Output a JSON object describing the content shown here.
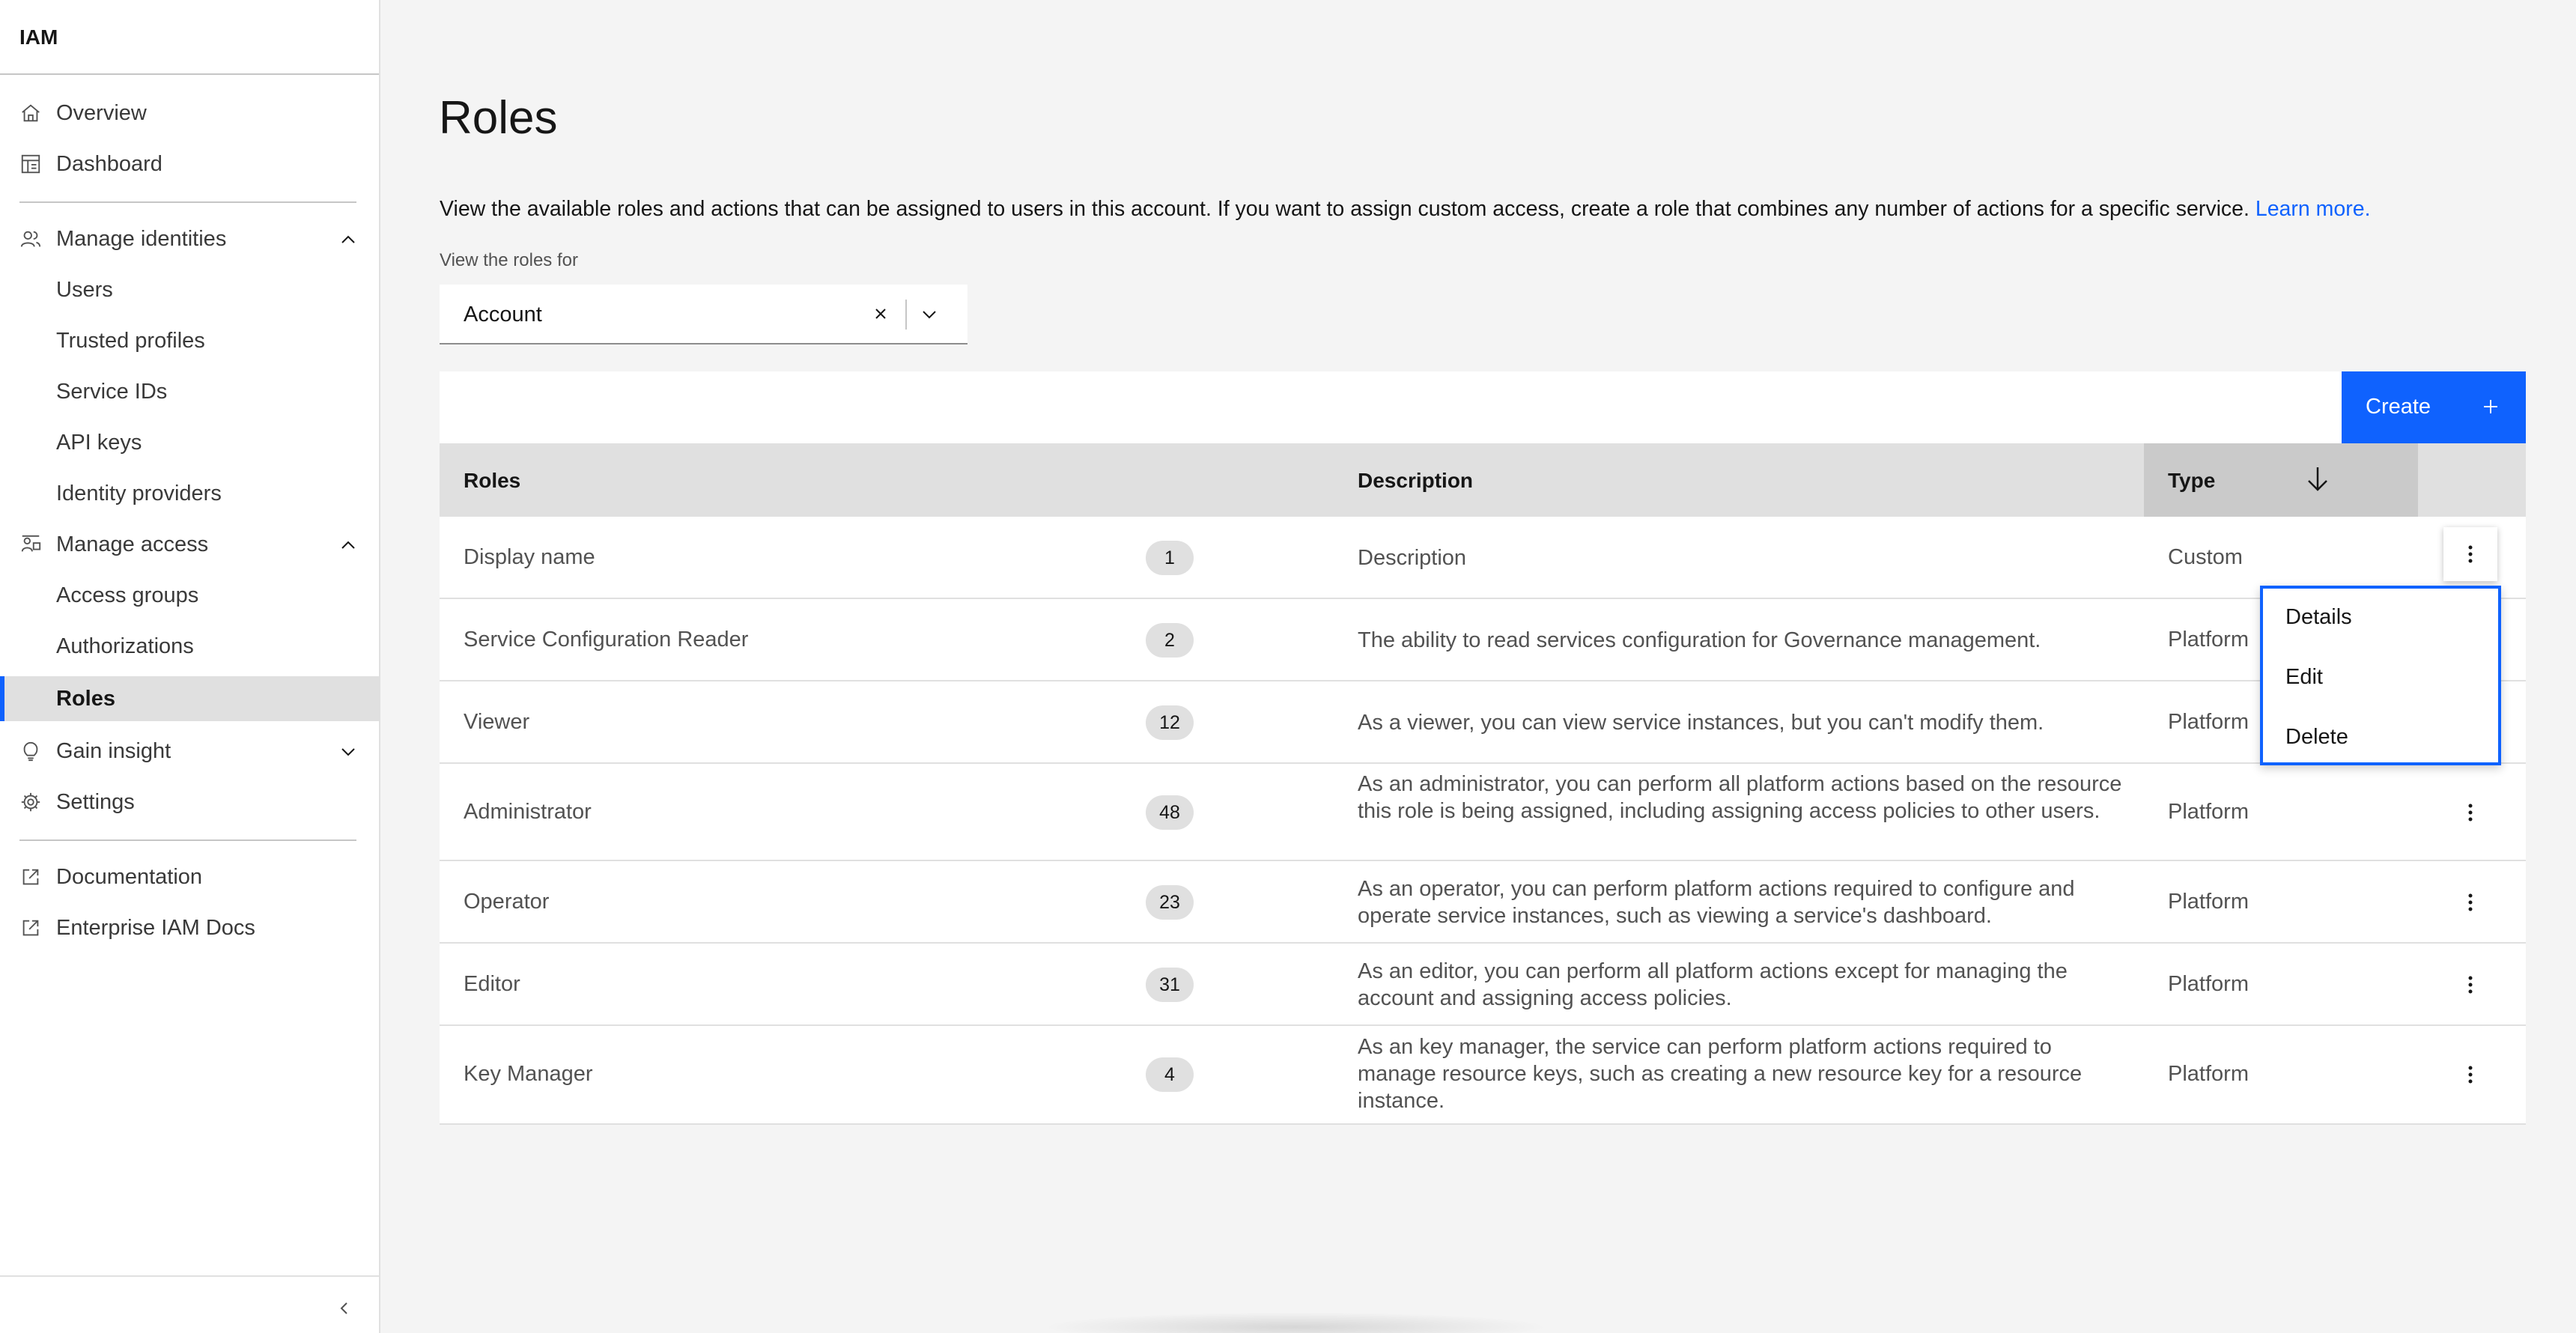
{
  "sidebar": {
    "title": "IAM",
    "items": {
      "overview": "Overview",
      "dashboard": "Dashboard",
      "manage_identities": "Manage identities",
      "users": "Users",
      "trusted_profiles": "Trusted profiles",
      "service_ids": "Service IDs",
      "api_keys": "API keys",
      "identity_providers": "Identity providers",
      "manage_access": "Manage access",
      "access_groups": "Access groups",
      "authorizations": "Authorizations",
      "roles": "Roles",
      "gain_insight": "Gain insight",
      "settings": "Settings",
      "documentation": "Documentation",
      "enterprise_docs": "Enterprise IAM Docs"
    }
  },
  "main": {
    "title": "Roles",
    "intro": "View the available roles and actions that can be assigned to users in this account. If you want to assign custom access, create a role that combines any number of actions for a specific service.",
    "learn_more": "Learn more.",
    "view_label": "View the roles for",
    "dropdown_value": "Account",
    "create_label": "Create"
  },
  "table": {
    "headers": {
      "roles": "Roles",
      "description": "Description",
      "type": "Type"
    },
    "rows": [
      {
        "name": "Display name",
        "count": "1",
        "description": "Description",
        "type": "Custom"
      },
      {
        "name": "Service Configuration Reader",
        "count": "2",
        "description": "The ability to read services configuration for Governance management.",
        "type": "Platform"
      },
      {
        "name": "Viewer",
        "count": "12",
        "description": "As a viewer, you can view service instances, but you can't modify them.",
        "type": "Platform"
      },
      {
        "name": "Administrator",
        "count": "48",
        "description": "As an administrator, you can perform all platform actions based on the resource this role is being assigned, including assigning access policies to other users.",
        "type": "Platform"
      },
      {
        "name": "Operator",
        "count": "23",
        "description": "As an operator, you can perform platform actions required to configure and operate service instances, such as viewing a service's dashboard.",
        "type": "Platform"
      },
      {
        "name": "Editor",
        "count": "31",
        "description": "As an editor, you can perform all platform actions except for managing the account and assigning access policies.",
        "type": "Platform"
      },
      {
        "name": "Key Manager",
        "count": "4",
        "description": "As an key manager, the service can perform platform actions required to manage resource keys, such as creating a new resource key for a resource instance.",
        "type": "Platform"
      }
    ]
  },
  "overflow_menu": {
    "details": "Details",
    "edit": "Edit",
    "delete": "Delete"
  },
  "colors": {
    "accent": "#0f62fe",
    "sidebar_active": "#e0e0e0",
    "header_bg": "#e0e0e0"
  },
  "icons": [
    "home-icon",
    "dashboard-icon",
    "users-icon",
    "access-icon",
    "bulb-icon",
    "gear-icon",
    "launch-icon",
    "chevron-up-icon",
    "chevron-down-icon",
    "close-icon",
    "plus-icon",
    "arrow-down-icon",
    "overflow-icon"
  ]
}
